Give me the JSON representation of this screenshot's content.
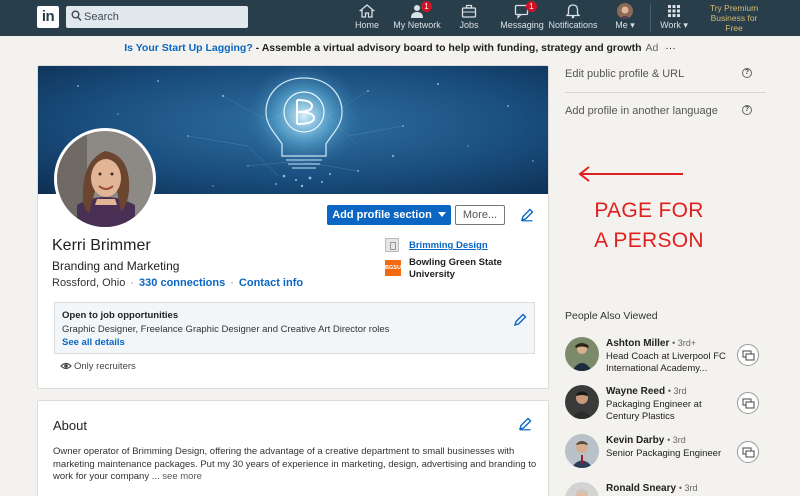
{
  "nav": {
    "logo": "in",
    "search_placeholder": "Search",
    "items": [
      {
        "label": "Home",
        "icon": "home-icon"
      },
      {
        "label": "My Network",
        "icon": "network-icon",
        "badge": "1"
      },
      {
        "label": "Jobs",
        "icon": "briefcase-icon"
      },
      {
        "label": "Messaging",
        "icon": "messaging-icon",
        "badge": "1"
      },
      {
        "label": "Notifications",
        "icon": "bell-icon"
      },
      {
        "label": "Me",
        "icon": "avatar"
      },
      {
        "label": "Work",
        "icon": "grid-icon"
      }
    ],
    "premium": "Try Premium Business for Free"
  },
  "ad": {
    "link": "Is Your Start Up Lagging?",
    "text": " - Assemble a virtual advisory board to help with funding, strategy and growth",
    "tag": "Ad",
    "more": "···"
  },
  "profile": {
    "add_section_label": "Add profile section",
    "more_label": "More...",
    "name": "Kerri Brimmer",
    "headline": "Branding and Marketing",
    "location": "Rossford, Ohio",
    "connections": "330 connections",
    "contact": "Contact info",
    "company": "Brimming Design",
    "school_logo_text": "BGSU",
    "school": "Bowling Green State University",
    "open_title": "Open to job opportunities",
    "open_roles": "Graphic Designer, Freelance Graphic Designer and Creative Art Director roles",
    "open_details": "See all details",
    "visibility": "Only recruiters"
  },
  "about": {
    "title": "About",
    "text": "Owner operator of Brimming Design, offering the advantage of a creative department to small businesses with marketing maintenance packages. Put my 30 years of experience in marketing, design, advertising and branding to work for your company ...",
    "see_more": "see more"
  },
  "rail": {
    "edit_profile": "Edit public profile & URL",
    "add_language": "Add profile in another language",
    "help": "?"
  },
  "annotation": {
    "line1": "PAGE FOR",
    "line2": "A PERSON",
    "color": "#e0201e"
  },
  "people_also_viewed": {
    "title": "People Also Viewed",
    "people": [
      {
        "name": "Ashton Miller",
        "degree": "• 3rd+",
        "desc": "Head Coach at Liverpool FC International Academy..."
      },
      {
        "name": "Wayne Reed",
        "degree": "• 3rd",
        "desc": "Packaging Engineer at Century Plastics"
      },
      {
        "name": "Kevin Darby",
        "degree": "• 3rd",
        "desc": "Senior Packaging Engineer"
      },
      {
        "name": "Ronald Sneary",
        "degree": "• 3rd",
        "desc": ""
      }
    ]
  },
  "colors": {
    "nav": "#283e4a",
    "accent": "#0a66c2",
    "background": "#f3f2ef"
  }
}
